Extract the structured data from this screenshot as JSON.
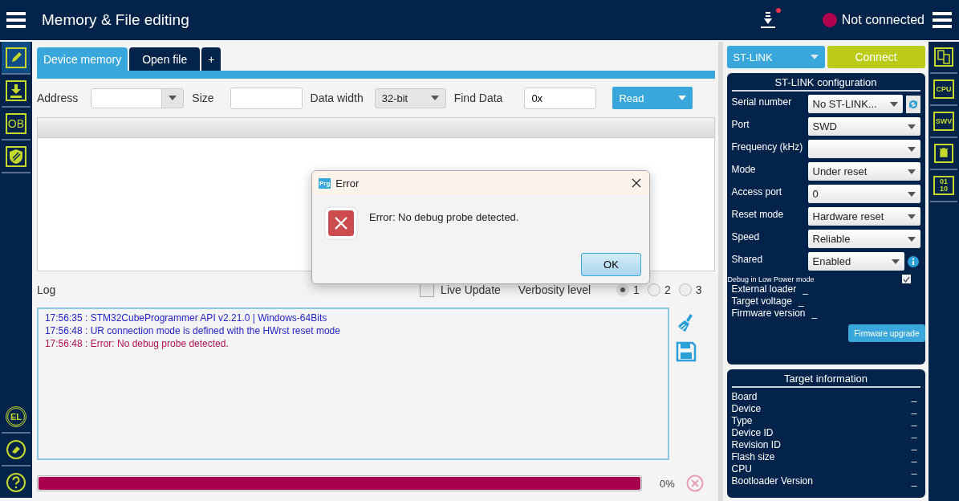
{
  "header": {
    "title": "Memory & File editing",
    "status": "Not connected",
    "connected": false,
    "download_notification": true
  },
  "left_sidebar": [
    {
      "kind": "edit",
      "selected": true
    },
    {
      "kind": "download",
      "selected": false
    },
    {
      "kind": "text",
      "label": "OB",
      "selected": false
    },
    {
      "kind": "shield",
      "selected": false
    }
  ],
  "left_sidebar_bottom": [
    {
      "kind": "chip",
      "label": "EL"
    },
    {
      "kind": "eraser"
    },
    {
      "kind": "help"
    }
  ],
  "tabs": [
    {
      "label": "Device memory",
      "selected": true
    },
    {
      "label": "Open file",
      "selected": false
    },
    {
      "label": "+",
      "selected": false
    }
  ],
  "toolbar": {
    "address_label": "Address",
    "size_label": "Size",
    "data_width_label": "Data width",
    "data_width": "32-bit",
    "find_label": "Find Data",
    "find_value": "0x",
    "read_button": "Read"
  },
  "log": {
    "title": "Log",
    "live_update": {
      "label": "Live Update",
      "checked": false
    },
    "verbosity_label": "Verbosity level",
    "verbosity": [
      {
        "label": "1",
        "selected": true
      },
      {
        "label": "2",
        "selected": false
      },
      {
        "label": "3",
        "selected": false
      }
    ],
    "lines": [
      {
        "kind": "info",
        "text": "17:56:35 : STM32CubeProgrammer API v2.21.0 | Windows-64Bits"
      },
      {
        "kind": "info",
        "text": "17:56:48 : UR connection mode is defined with the HWrst reset mode"
      },
      {
        "kind": "error",
        "text": "17:56:48 : Error: No debug probe detected."
      }
    ]
  },
  "progress": {
    "level": 1,
    "reading": "0%"
  },
  "dialog": {
    "title": "Error",
    "app_badge": "Prg",
    "kind": "error",
    "message": "Error: No debug probe detected.",
    "button": "OK"
  },
  "interface": {
    "value": "ST-LINK",
    "connect_button": "Connect"
  },
  "config": {
    "title": "ST-LINK configuration",
    "fields": [
      {
        "label": "Serial number",
        "value": "No ST-LINK...",
        "kind": "refresh"
      },
      {
        "label": "Port",
        "value": "SWD",
        "kind": "select"
      },
      {
        "label": "Frequency (kHz)",
        "kind": "select"
      },
      {
        "label": "Mode",
        "value": "Under reset",
        "kind": "select"
      },
      {
        "label": "Access port",
        "value": "0",
        "kind": "select"
      },
      {
        "label": "Reset mode",
        "value": "Hardware reset",
        "kind": "select"
      },
      {
        "label": "Speed",
        "value": "Reliable",
        "kind": "select"
      },
      {
        "label": "Shared",
        "value": "Enabled",
        "kind": "info"
      }
    ],
    "low_power": {
      "label": "Debug in Low Power mode",
      "checked": true
    },
    "info": [
      {
        "label": "External loader",
        "value": "_"
      },
      {
        "label": "Target voltage",
        "value": "_"
      },
      {
        "label": "Firmware version",
        "value": "_"
      }
    ],
    "firmware_button": "Firmware upgrade"
  },
  "target": {
    "title": "Target information",
    "rows": [
      {
        "label": "Board",
        "value": "_"
      },
      {
        "label": "Device",
        "value": "_"
      },
      {
        "label": "Type",
        "value": "_"
      },
      {
        "label": "Device ID",
        "value": "_"
      },
      {
        "label": "Revision ID",
        "value": "_"
      },
      {
        "label": "Flash size",
        "value": "_"
      },
      {
        "label": "CPU",
        "value": "_"
      },
      {
        "label": "Bootloader Version",
        "value": "_"
      }
    ]
  },
  "right_sidebar": [
    {
      "kind": "copy"
    },
    {
      "kind": "text",
      "label": "CPU"
    },
    {
      "kind": "text",
      "label": "SWV"
    },
    {
      "kind": "bug"
    },
    {
      "kind": "text",
      "label": "01 10"
    }
  ]
}
